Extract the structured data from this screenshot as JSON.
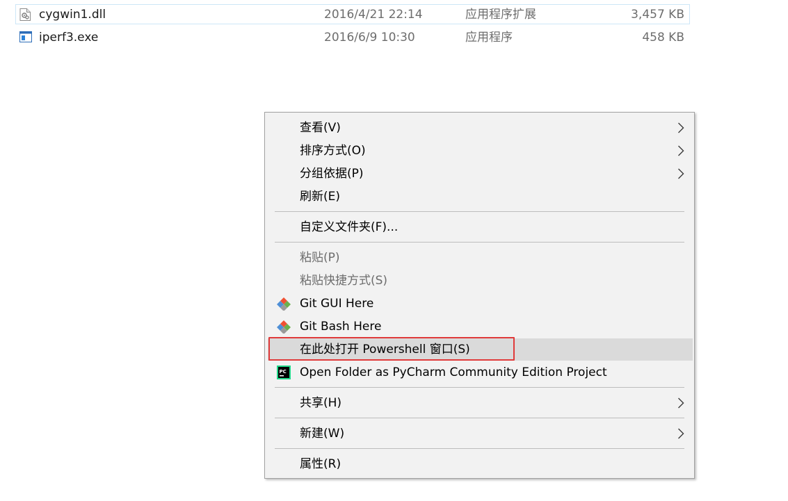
{
  "files": [
    {
      "name": "cygwin1.dll",
      "date": "2016/4/21 22:14",
      "type": "应用程序扩展",
      "size": "3,457 KB",
      "icon": "dll-file-icon"
    },
    {
      "name": "iperf3.exe",
      "date": "2016/6/9 10:30",
      "type": "应用程序",
      "size": "458 KB",
      "icon": "exe-file-icon"
    }
  ],
  "menu": {
    "items": [
      {
        "label": "查看(V)",
        "submenu": true
      },
      {
        "label": "排序方式(O)",
        "submenu": true
      },
      {
        "label": "分组依据(P)",
        "submenu": true
      },
      {
        "label": "刷新(E)"
      },
      {
        "label": "自定义文件夹(F)..."
      },
      {
        "label": "粘贴(P)",
        "disabled": true
      },
      {
        "label": "粘贴快捷方式(S)",
        "disabled": true
      },
      {
        "label": "Git GUI Here",
        "icon": "git-gui-icon"
      },
      {
        "label": "Git Bash Here",
        "icon": "git-bash-icon"
      },
      {
        "label": "在此处打开 Powershell 窗口(S)",
        "hovered": true,
        "highlighted": true
      },
      {
        "label": "Open Folder as PyCharm Community Edition Project",
        "icon": "pycharm-icon"
      },
      {
        "label": "共享(H)",
        "submenu": true
      },
      {
        "label": "新建(W)",
        "submenu": true
      },
      {
        "label": "属性(R)"
      }
    ]
  },
  "colors": {
    "highlight_border": "#e03a3a",
    "menu_background": "#f2f2f2",
    "hover_background": "#dadada",
    "disabled_text": "#6d6d6d"
  }
}
